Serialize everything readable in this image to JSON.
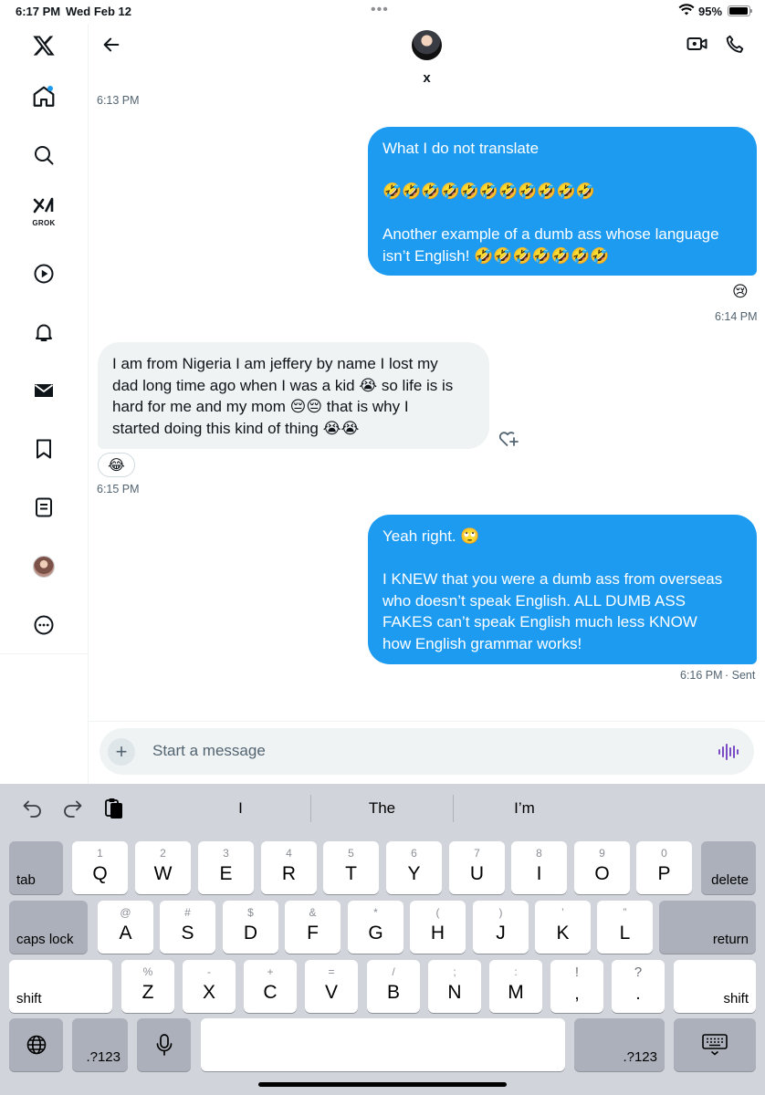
{
  "status_bar": {
    "time": "6:17 PM",
    "date": "Wed Feb 12",
    "battery": "95%",
    "battery_level": 0.95
  },
  "sidebar": {
    "items": [
      {
        "name": "x-logo",
        "icon": "x-logo-icon"
      },
      {
        "name": "home",
        "icon": "home-icon",
        "has_notification_dot": true
      },
      {
        "name": "explore",
        "icon": "search-icon"
      },
      {
        "name": "grok",
        "icon": "grok-icon",
        "label": "GROK"
      },
      {
        "name": "videos",
        "icon": "play-icon"
      },
      {
        "name": "notifications",
        "icon": "bell-icon"
      },
      {
        "name": "messages",
        "icon": "mail-icon"
      },
      {
        "name": "bookmarks",
        "icon": "bookmark-icon"
      },
      {
        "name": "lists",
        "icon": "list-icon"
      },
      {
        "name": "profile",
        "icon": "avatar"
      },
      {
        "name": "more",
        "icon": "more-icon"
      }
    ]
  },
  "header": {
    "name": "x"
  },
  "messages": [
    {
      "direction": "timestamp",
      "time": "6:13 PM"
    },
    {
      "direction": "outgoing",
      "lines": [
        "What I do not translate",
        "",
        "🤣🤣🤣🤣🤣🤣🤣🤣🤣🤣🤣",
        "",
        "Another example of a dumb ass whose language",
        "isn’t English! 🤣🤣🤣🤣🤣🤣🤣"
      ],
      "reaction": "😢",
      "time": "6:14 PM"
    },
    {
      "direction": "incoming",
      "lines": [
        "I am from Nigeria I am jeffery by name I lost my",
        "dad long time ago when I was a kid 😭 so life is is",
        "hard for me and my mom 😔😔 that is why I",
        "started doing this kind of thing 😭😭"
      ],
      "reaction": "😂",
      "time": "6:15 PM"
    },
    {
      "direction": "outgoing",
      "lines": [
        "Yeah right. 🙄",
        "",
        "I KNEW that you were a dumb ass from overseas",
        "who doesn’t speak English. ALL DUMB ASS",
        "FAKES can’t speak English much less KNOW",
        "how English grammar works!"
      ],
      "time": "6:16 PM",
      "status": "· Sent"
    }
  ],
  "composer": {
    "placeholder": "Start a message"
  },
  "keyboard": {
    "suggestions": [
      "I",
      "The",
      "I’m"
    ],
    "row1": [
      {
        "hint": "1",
        "key": "Q"
      },
      {
        "hint": "2",
        "key": "W"
      },
      {
        "hint": "3",
        "key": "E"
      },
      {
        "hint": "4",
        "key": "R"
      },
      {
        "hint": "5",
        "key": "T"
      },
      {
        "hint": "6",
        "key": "Y"
      },
      {
        "hint": "7",
        "key": "U"
      },
      {
        "hint": "8",
        "key": "I"
      },
      {
        "hint": "9",
        "key": "O"
      },
      {
        "hint": "0",
        "key": "P"
      }
    ],
    "row2": [
      {
        "hint": "@",
        "key": "A"
      },
      {
        "hint": "#",
        "key": "S"
      },
      {
        "hint": "$",
        "key": "D"
      },
      {
        "hint": "&",
        "key": "F"
      },
      {
        "hint": "*",
        "key": "G"
      },
      {
        "hint": "(",
        "key": "H"
      },
      {
        "hint": ")",
        "key": "J"
      },
      {
        "hint": "’",
        "key": "K"
      },
      {
        "hint": "”",
        "key": "L"
      }
    ],
    "row3": [
      {
        "hint": "%",
        "key": "Z"
      },
      {
        "hint": "-",
        "key": "X"
      },
      {
        "hint": "+",
        "key": "C"
      },
      {
        "hint": "=",
        "key": "V"
      },
      {
        "hint": "/",
        "key": "B"
      },
      {
        "hint": ";",
        "key": "N"
      },
      {
        "hint": ":",
        "key": "M"
      }
    ],
    "punct": [
      {
        "top": "!",
        "bottom": ","
      },
      {
        "top": "?",
        "bottom": "."
      }
    ],
    "tab": "tab",
    "delete": "delete",
    "caps_lock": "caps lock",
    "return": "return",
    "shift": "shift",
    "numbers": ".?123"
  }
}
